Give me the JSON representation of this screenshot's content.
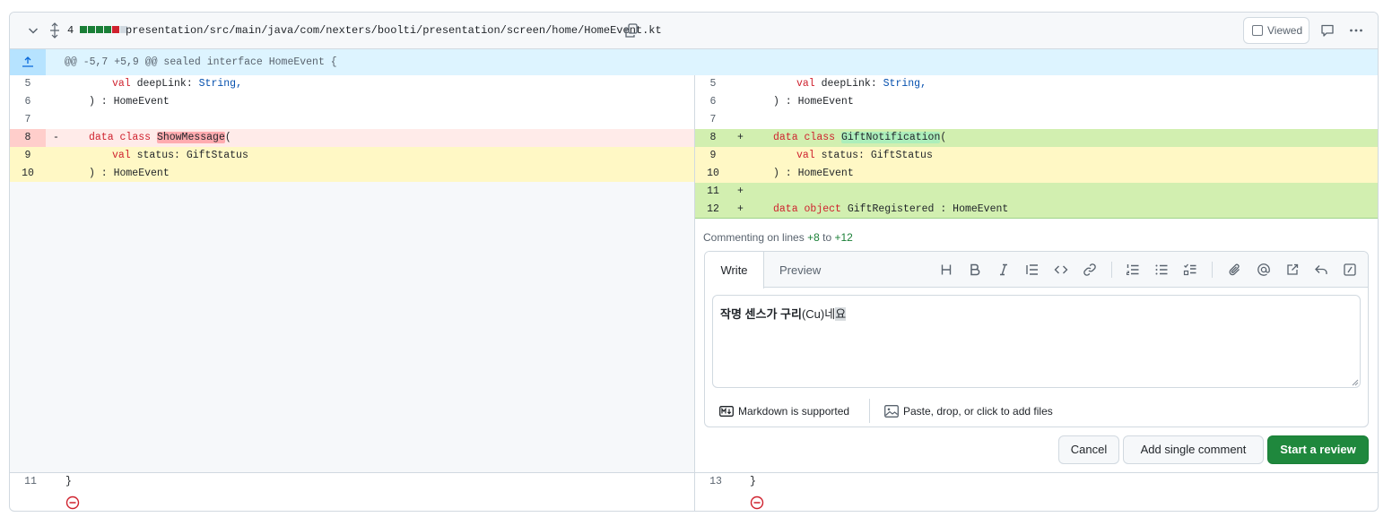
{
  "header": {
    "change_count": "4",
    "diffstat_colors": [
      "#1a7f37",
      "#1a7f37",
      "#1a7f37",
      "#1a7f37",
      "#cf222e",
      "#d1d9e0"
    ],
    "file_path": "presentation/src/main/java/com/nexters/boolti/presentation/screen/home/HomeEvent.kt",
    "viewed_label": "Viewed",
    "icons": [
      "chevron-down-icon",
      "expand-icon",
      "copy-icon",
      "comment-icon",
      "kebab-icon"
    ]
  },
  "hunk": {
    "text": "@@ -5,7 +5,9 @@ sealed interface HomeEvent {"
  },
  "left_lines": [
    {
      "num": "5",
      "marker": ""
    },
    {
      "num": "6",
      "marker": ""
    },
    {
      "num": "7",
      "marker": ""
    },
    {
      "num": "8",
      "marker": "-"
    },
    {
      "num": "9",
      "marker": ""
    },
    {
      "num": "10",
      "marker": ""
    },
    {
      "num": "11",
      "marker": ""
    }
  ],
  "right_lines": [
    {
      "num": "5",
      "marker": ""
    },
    {
      "num": "6",
      "marker": ""
    },
    {
      "num": "7",
      "marker": ""
    },
    {
      "num": "8",
      "marker": "+"
    },
    {
      "num": "9",
      "marker": ""
    },
    {
      "num": "10",
      "marker": ""
    },
    {
      "num": "11",
      "marker": "+"
    },
    {
      "num": "12",
      "marker": "+"
    },
    {
      "num": "13",
      "marker": ""
    }
  ],
  "code": {
    "val": "val",
    "deeplink_name": "deepLink:",
    "string_type": "String,",
    "close_home": ") : HomeEvent",
    "data": "data",
    "class": "class",
    "object": "object",
    "show_message": "ShowMessage",
    "gift_notification": "GiftNotification",
    "open_paren": "(",
    "status_decl": "status: GiftStatus",
    "gift_registered": "GiftRegistered : HomeEvent",
    "close_brace": "}"
  },
  "comment_form": {
    "commenting_prefix": "Commenting on lines",
    "from_line": "+8",
    "to_word": "to",
    "to_line": "+12",
    "tab_write": "Write",
    "tab_preview": "Preview",
    "toolbar_icons": [
      "heading-icon",
      "bold-icon",
      "italic-icon",
      "quote-icon",
      "code-icon",
      "link-icon",
      "ordered-list-icon",
      "unordered-list-icon",
      "task-list-icon",
      "attach-icon",
      "mention-icon",
      "cross-reference-icon",
      "reply-icon",
      "slash-command-icon"
    ],
    "textarea_bold": "작명 센스가 구리",
    "textarea_normal": "(Cu)네",
    "textarea_selected": "요",
    "markdown_label": "Markdown is supported",
    "attach_label": "Paste, drop, or click to add files",
    "cancel_label": "Cancel",
    "add_single_label": "Add single comment",
    "start_review_label": "Start a review"
  },
  "colors": {
    "deletion_bg": "#ffebe9",
    "deletion_gutter": "#ffcecb",
    "addition_bg": "#dafbe1",
    "addition_line": "#ccffd8",
    "selected_row": "#fff8c5",
    "primary_button": "#1f883d",
    "hunk_bg": "#ddf4ff"
  }
}
